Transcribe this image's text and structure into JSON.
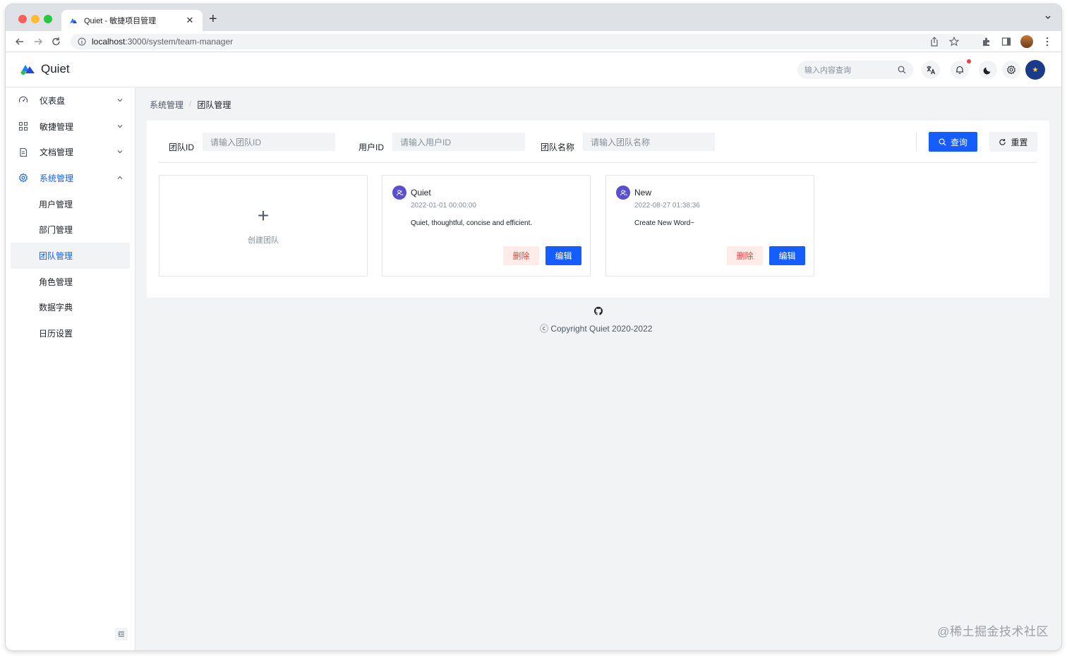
{
  "browser": {
    "tab_title": "Quiet - 敏捷项目管理",
    "close_glyph": "✕",
    "new_tab_glyph": "+",
    "url_host": "localhost",
    "url_rest": ":3000/system/team-manager"
  },
  "header": {
    "app_name": "Quiet",
    "search_placeholder": "输入内容查询",
    "accent": "#165dff"
  },
  "sidebar": {
    "items": [
      {
        "label": "仪表盘",
        "icon": "dashboard-icon",
        "expanded": false
      },
      {
        "label": "敏捷管理",
        "icon": "apps-icon",
        "expanded": false
      },
      {
        "label": "文档管理",
        "icon": "file-icon",
        "expanded": false
      },
      {
        "label": "系统管理",
        "icon": "settings-icon",
        "expanded": true,
        "active": true
      }
    ],
    "subitems": [
      {
        "label": "用户管理"
      },
      {
        "label": "部门管理"
      },
      {
        "label": "团队管理",
        "active": true
      },
      {
        "label": "角色管理"
      },
      {
        "label": "数据字典"
      },
      {
        "label": "日历设置"
      }
    ]
  },
  "breadcrumb": {
    "parent": "系统管理",
    "separator": "/",
    "current": "团队管理"
  },
  "filters": {
    "team_id_label": "团队ID",
    "team_id_placeholder": "请输入团队ID",
    "user_id_label": "用户ID",
    "user_id_placeholder": "请输入用户ID",
    "team_name_label": "团队名称",
    "team_name_placeholder": "请输入团队名称",
    "query_button": "查询",
    "reset_button": "重置"
  },
  "create_card": {
    "plus": "+",
    "label": "创建团队"
  },
  "teams": [
    {
      "name": "Quiet",
      "date": "2022-01-01 00:00:00",
      "description": "Quiet, thoughtful, concise and efficient.",
      "delete_label": "删除",
      "edit_label": "编辑"
    },
    {
      "name": "New",
      "date": "2022-08-27 01:38:36",
      "description": "Create New Word~",
      "delete_label": "删除",
      "edit_label": "编辑"
    }
  ],
  "footer": {
    "copyright": "ⓒ Copyright Quiet 2020-2022"
  },
  "watermark": "@稀土掘金技术社区"
}
